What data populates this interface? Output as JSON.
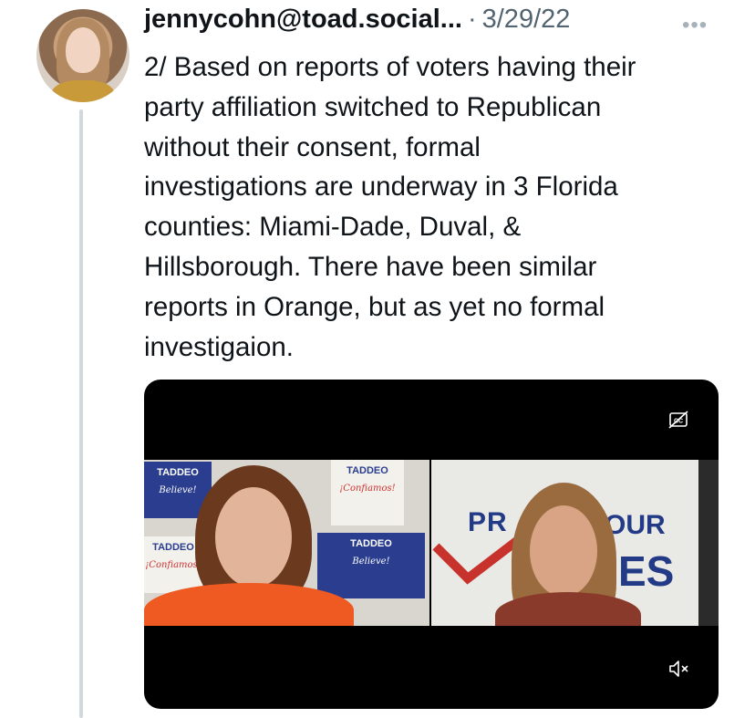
{
  "tweet": {
    "handle": "jennycohn@toad.social...",
    "separator": "·",
    "date": "3/29/22",
    "more_label": "•••",
    "text_lines": [
      "2/ Based on reports of voters having their",
      "party affiliation switched to Republican",
      "without their consent, formal",
      "investigations are underway in 3 Florida",
      "counties: Miami-Dade, Duval, &",
      "Hillsborough. There have been similar",
      "reports in Orange, but as yet no formal",
      "investigaion."
    ]
  },
  "video": {
    "signs": {
      "taddeo": "TADDEO",
      "believe": "Believe!",
      "confiamos": "¡Confiamos!"
    },
    "poster": {
      "part1": "PR",
      "part2": "OUR",
      "part3": "ES"
    },
    "icons": {
      "captions": "closed-captions-off-icon",
      "mute": "speaker-muted-icon"
    }
  },
  "colors": {
    "text": "#0f1419",
    "secondary": "#536471",
    "thread_line": "#cfd9de",
    "video_bg": "#000000"
  }
}
